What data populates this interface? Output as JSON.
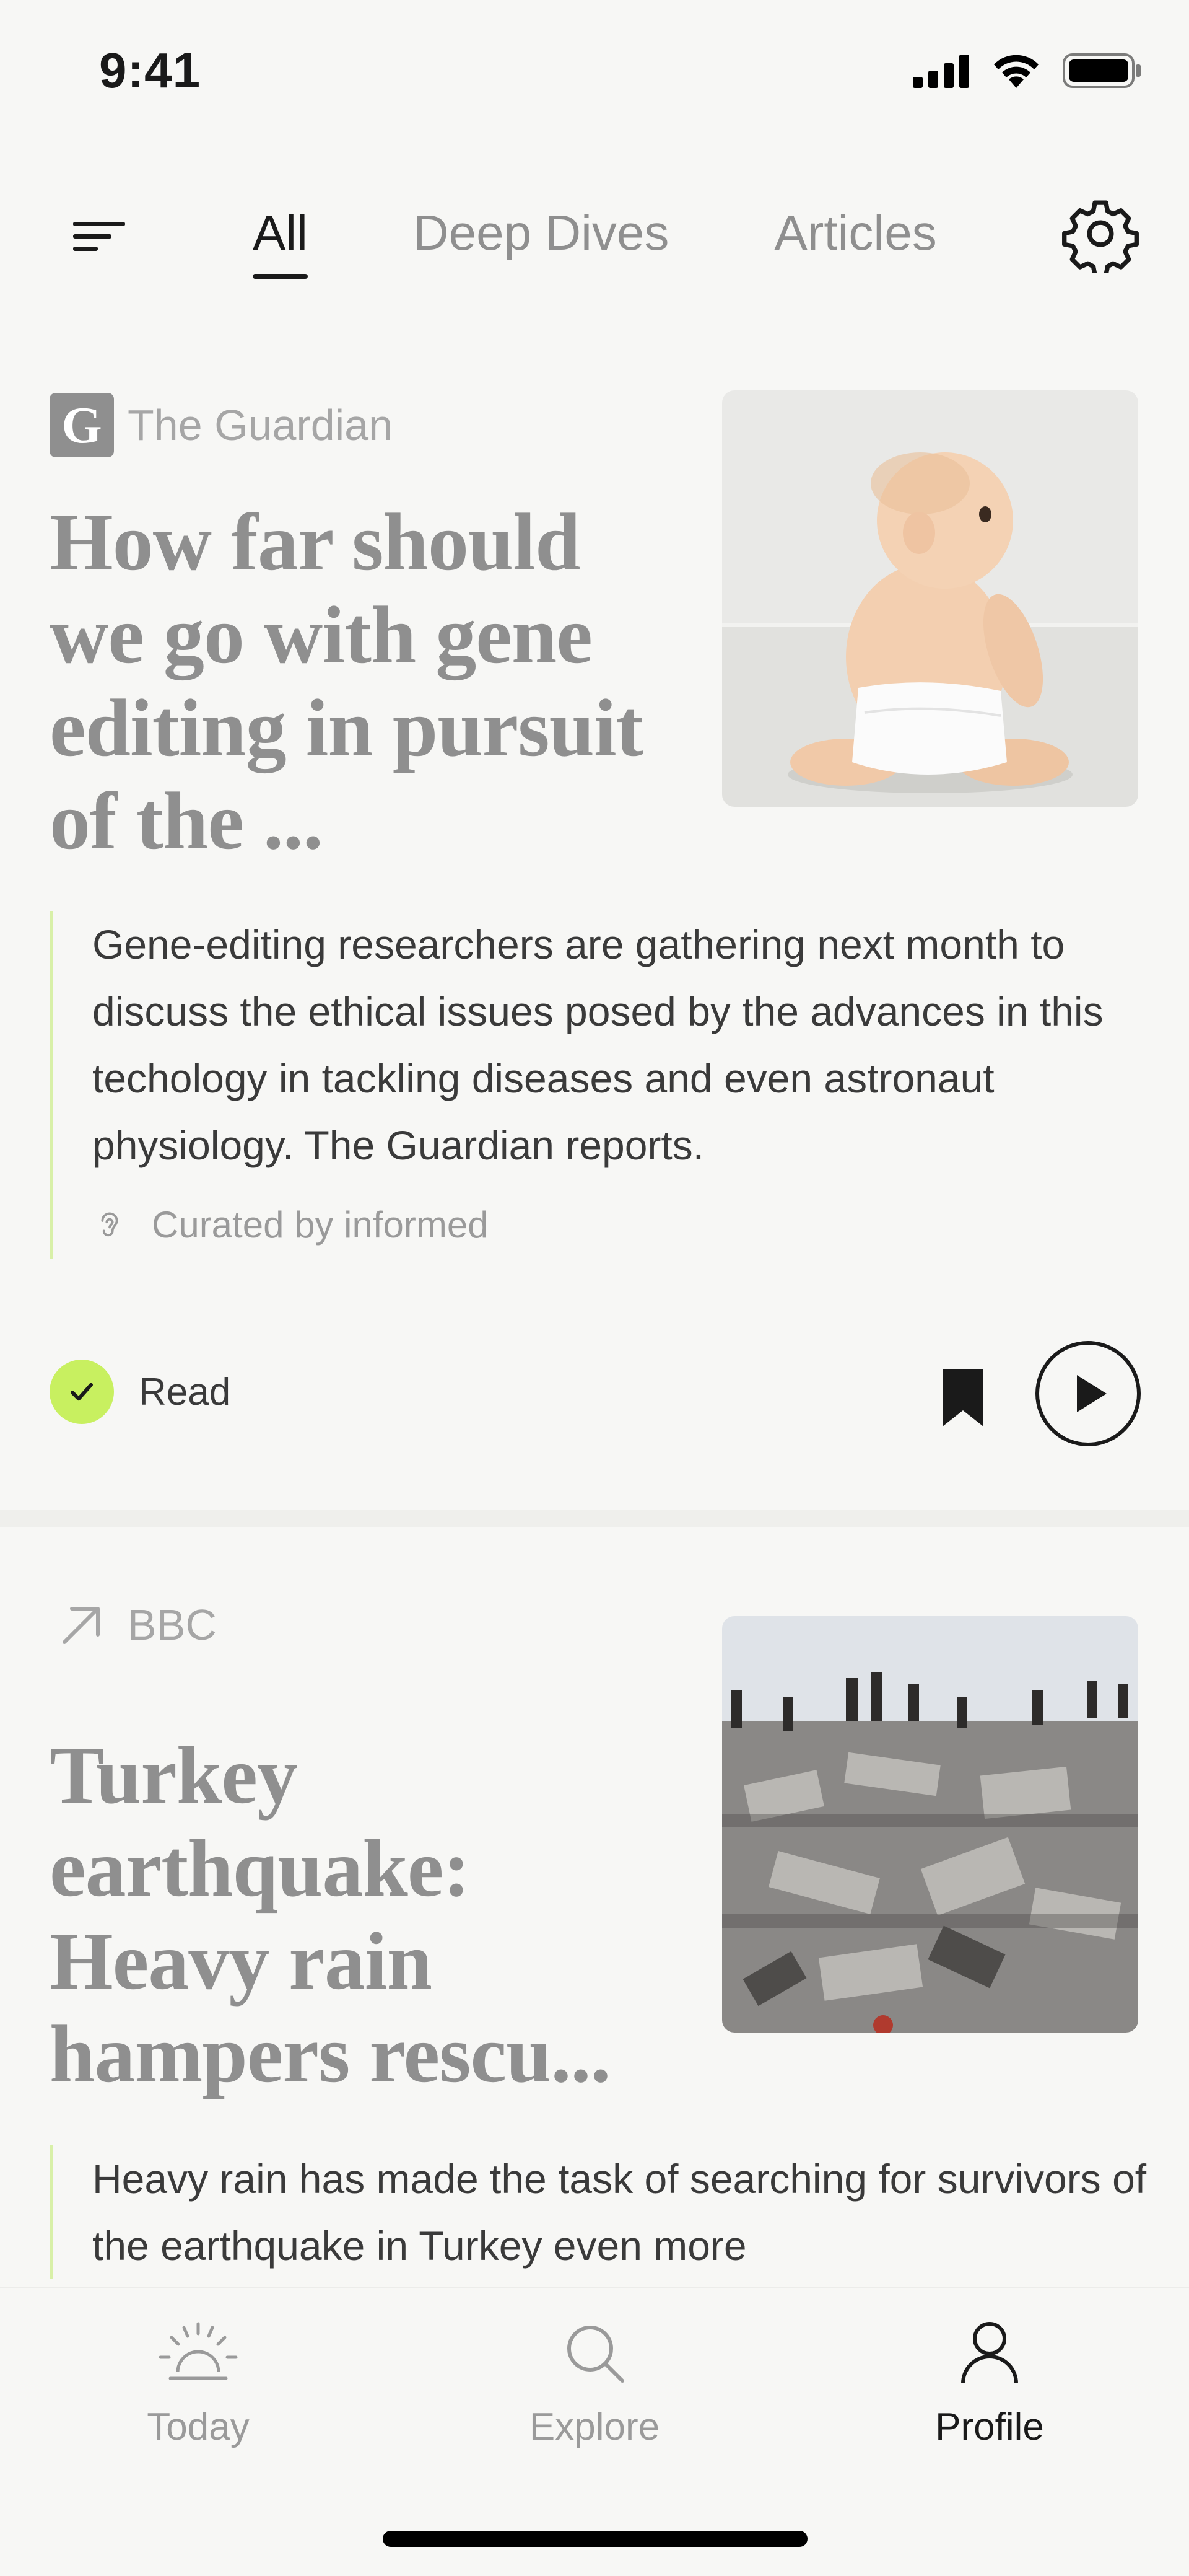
{
  "status_bar": {
    "time": "9:41"
  },
  "top_nav": {
    "tabs": [
      {
        "label": "All",
        "active": true
      },
      {
        "label": "Deep Dives",
        "active": false
      },
      {
        "label": "Articles",
        "active": false
      }
    ]
  },
  "articles": [
    {
      "source": "The Guardian",
      "source_logo_letter": "G",
      "headline": "How far should we go with gene editing in pursuit of the ...",
      "summary": "Gene-editing researchers are gathering next month to discuss the ethical issues posed by the advances in this techology in tackling diseases and even astronaut physiology. The Guardian reports.",
      "curated": "Curated by informed",
      "read_label": "Read",
      "image_icon": "baby-photo"
    },
    {
      "source": "BBC",
      "headline": "Turkey earthquake: Heavy rain hampers rescu...",
      "summary": "Heavy rain has made the task of searching for survivors of the earthquake in Turkey even more",
      "image_icon": "earthquake-rubble-photo"
    }
  ],
  "tab_bar": {
    "items": [
      {
        "label": "Today",
        "icon": "sunrise-icon",
        "active": false
      },
      {
        "label": "Explore",
        "icon": "search-icon",
        "active": false
      },
      {
        "label": "Profile",
        "icon": "person-icon",
        "active": true
      }
    ]
  },
  "colors": {
    "background": "#f7f7f5",
    "accent_green": "#c8f060",
    "summary_rule": "#d8f0a8",
    "muted_text": "#8f8f8f"
  }
}
